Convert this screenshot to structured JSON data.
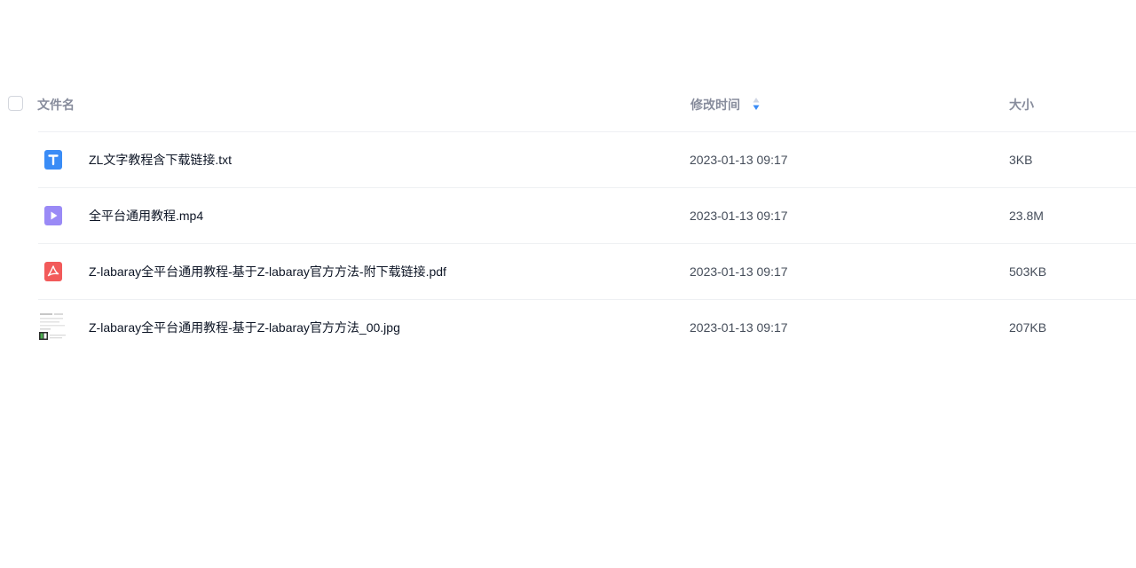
{
  "header": {
    "name_label": "文件名",
    "time_label": "修改时间",
    "size_label": "大小",
    "sort_icon": "sort-arrows-icon"
  },
  "colors": {
    "txt": "#3a8cf6",
    "video": "#9a8af6",
    "pdf": "#f25a5a"
  },
  "files": [
    {
      "name": "ZL文字教程含下载链接.txt",
      "modified": "2023-01-13 09:17",
      "size": "3KB",
      "icon": "txt-file-icon"
    },
    {
      "name": "全平台通用教程.mp4",
      "modified": "2023-01-13 09:17",
      "size": "23.8M",
      "icon": "video-file-icon"
    },
    {
      "name": "Z-labaray全平台通用教程-基于Z-labaray官方方法-附下载链接.pdf",
      "modified": "2023-01-13 09:17",
      "size": "503KB",
      "icon": "pdf-file-icon"
    },
    {
      "name": "Z-labaray全平台通用教程-基于Z-labaray官方方法_00.jpg",
      "modified": "2023-01-13 09:17",
      "size": "207KB",
      "icon": "image-thumbnail"
    }
  ]
}
